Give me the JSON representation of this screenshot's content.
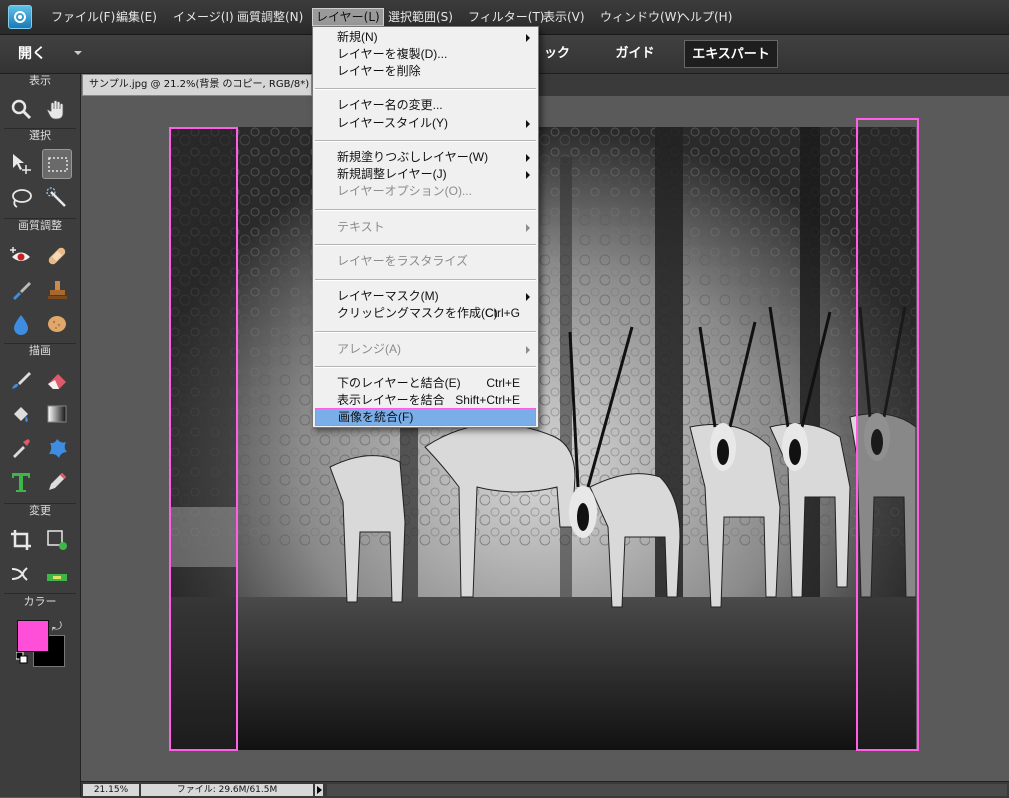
{
  "menubar": {
    "items": [
      "ファイル(F)",
      "編集(E)",
      "イメージ(I)",
      "画質調整(N)",
      "レイヤー(L)",
      "選択範囲(S)",
      "フィルター(T)",
      "表示(V)",
      "ウィンドウ(W)",
      "ヘルプ(H)"
    ],
    "active": "レイヤー(L)"
  },
  "optbar": {
    "open_label": "開く",
    "quick_label": "ック",
    "guide_label": "ガイド",
    "expert_label": "エキスパート"
  },
  "toolbox": {
    "headers": {
      "view": "表示",
      "select": "選択",
      "enhance": "画質調整",
      "draw": "描画",
      "modify": "変更",
      "color": "カラー"
    },
    "foreground_color": "#ff4fd8",
    "background_color": "#000000"
  },
  "document": {
    "tab_title": "サンプル.jpg @ 21.2%(背景 のコピー, RGB/8*) *"
  },
  "status": {
    "zoom": "21.15%",
    "file_info": "ファイル: 29.6M/61.5M"
  },
  "layer_menu": {
    "items": [
      {
        "label": "新規(N)",
        "submenu": true
      },
      {
        "label": "レイヤーを複製(D)..."
      },
      {
        "label": "レイヤーを削除"
      },
      {
        "label": "レイヤー名の変更..."
      },
      {
        "label": "レイヤースタイル(Y)",
        "submenu": true
      },
      {
        "label": "新規塗りつぶしレイヤー(W)",
        "submenu": true
      },
      {
        "label": "新規調整レイヤー(J)",
        "submenu": true
      },
      {
        "label": "レイヤーオプション(O)...",
        "disabled": true
      },
      {
        "label": "テキスト",
        "submenu": true,
        "disabled": true
      },
      {
        "label": "レイヤーをラスタライズ",
        "disabled": true
      },
      {
        "label": "レイヤーマスク(M)",
        "submenu": true
      },
      {
        "label": "クリッピングマスクを作成(C)",
        "shortcut": "Ctrl+G"
      },
      {
        "label": "アレンジ(A)",
        "submenu": true,
        "disabled": true
      },
      {
        "label": "下のレイヤーと結合(E)",
        "shortcut": "Ctrl+E"
      },
      {
        "label": "表示レイヤーを結合",
        "shortcut": "Shift+Ctrl+E"
      },
      {
        "label": "画像を統合(F)",
        "highlighted": true
      }
    ]
  },
  "colors": {
    "guide": "#ff5ee6",
    "highlight": "#7aaee8"
  }
}
